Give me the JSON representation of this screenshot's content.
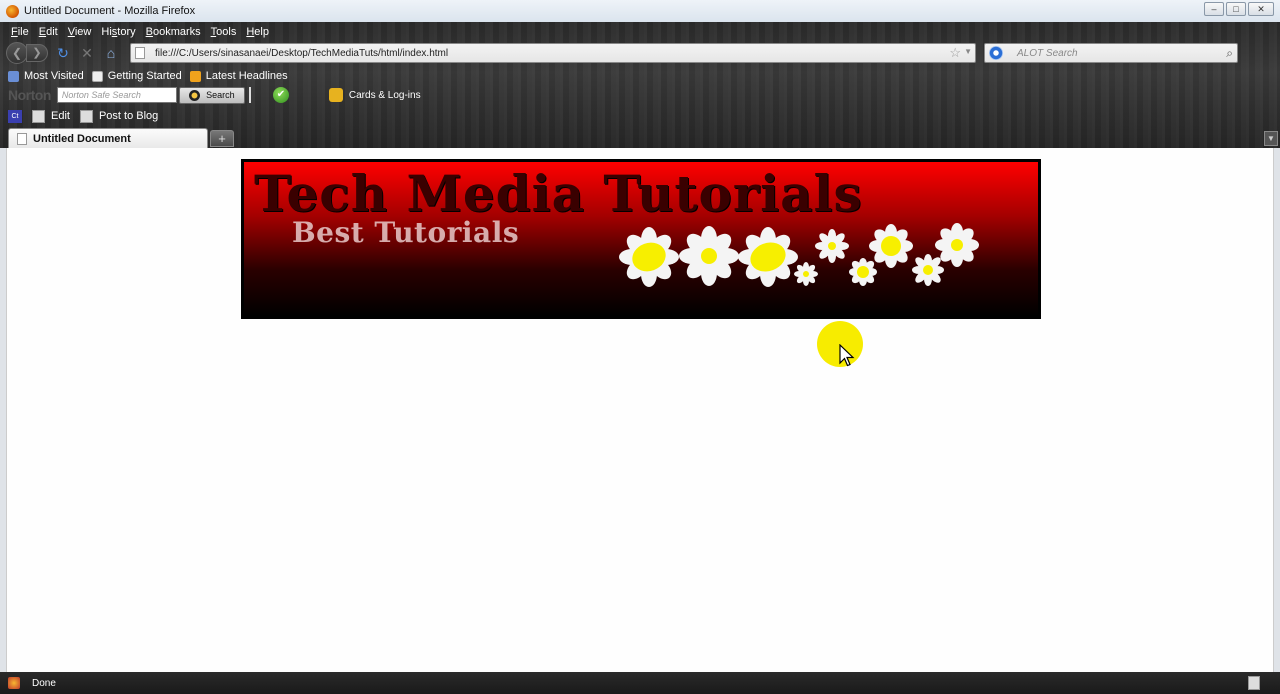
{
  "window": {
    "title": "Untitled Document - Mozilla Firefox",
    "controls": [
      "–",
      "□",
      "✕"
    ]
  },
  "menubar": {
    "items": [
      {
        "accel": "F",
        "rest": "ile"
      },
      {
        "accel": "E",
        "rest": "dit"
      },
      {
        "accel": "V",
        "rest": "iew"
      },
      {
        "accel": "",
        "pre": "Hi",
        "accel2": "s",
        "rest": "tory"
      },
      {
        "accel": "B",
        "rest": "ookmarks"
      },
      {
        "accel": "T",
        "rest": "ools"
      },
      {
        "accel": "H",
        "rest": "elp"
      }
    ]
  },
  "navbar": {
    "url": "file:///C:/Users/sinasanaei/Desktop/TechMediaTuts/html/index.html",
    "search_placeholder": "ALOT Search"
  },
  "bookmarks": {
    "items": [
      "Most Visited",
      "Getting Started",
      "Latest Headlines"
    ]
  },
  "norton": {
    "logo": "Norton",
    "placeholder": "Norton Safe Search",
    "search_button": "Search",
    "cards_label": "Cards & Log-ins"
  },
  "toolbar2": {
    "ct_label": "Ct",
    "edit_label": "Edit",
    "post_label": "Post to Blog"
  },
  "tabs": {
    "active_label": "Untitled Document",
    "new_tab": "+"
  },
  "banner": {
    "title": "Tech Media Tutorials",
    "subtitle": "Best Tutorials"
  },
  "status": {
    "text": "Done"
  },
  "colors": {
    "banner_top": "#ff0000",
    "banner_bottom": "#000000",
    "cursor_highlight": "#f7ec00"
  }
}
